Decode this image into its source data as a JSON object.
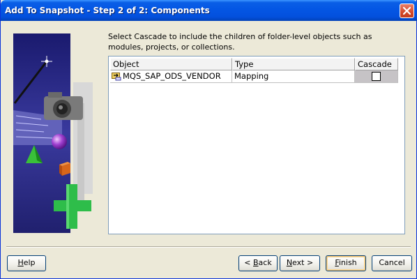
{
  "window": {
    "title": "Add To Snapshot - Step 2 of 2: Components",
    "close_label": "×"
  },
  "instruction": "Select Cascade to include the children of folder-level objects such as modules, projects, or collections.",
  "table": {
    "columns": [
      "Object",
      "Type",
      "Cascade"
    ],
    "rows": [
      {
        "object": "MQS_SAP_ODS_VENDOR",
        "type": "Mapping",
        "cascade": false
      }
    ]
  },
  "buttons": {
    "help": {
      "pre": "",
      "accel": "H",
      "post": "elp"
    },
    "back": {
      "pre": "< ",
      "accel": "B",
      "post": "ack"
    },
    "next": {
      "pre": "",
      "accel": "N",
      "post": "ext >"
    },
    "finish": {
      "pre": "",
      "accel": "F",
      "post": "inish"
    },
    "cancel": {
      "pre": "",
      "accel": "",
      "post": "Cancel"
    }
  },
  "colors": {
    "titlebar": "#0456e4",
    "dialog_bg": "#ece9d8",
    "art_bg": "#2a2a8a",
    "cascade_cell": "#c6c3c6",
    "finish_focus": "#f6c87a"
  },
  "icons": {
    "close": "close-icon",
    "mapping": "mapping-icon"
  }
}
